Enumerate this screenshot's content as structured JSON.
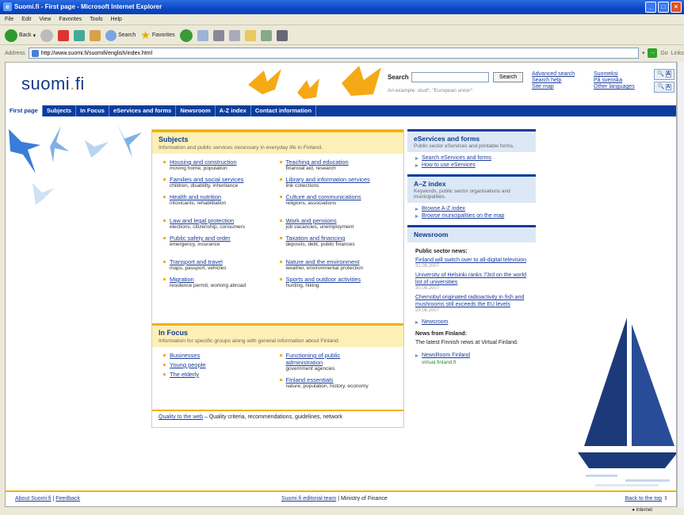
{
  "window": {
    "title": "Suomi.fi - First page - Microsoft Internet Explorer",
    "ie_logo": "e"
  },
  "menu": [
    "File",
    "Edit",
    "View",
    "Favorites",
    "Tools",
    "Help"
  ],
  "toolbar": {
    "back": "Back",
    "search": "Search",
    "favorites": "Favorites"
  },
  "address": {
    "label": "Address",
    "url": "http://www.suomi.fi/suomifi/english/index.html",
    "go": "Go",
    "links": "Links"
  },
  "site": {
    "logo_main": "suomi",
    "logo_dot": ".",
    "logo_tld": "fi"
  },
  "search": {
    "label": "Search",
    "button": "Search",
    "hint": "An example: stud*, \"European union\""
  },
  "header_links": [
    "Advanced search",
    "Search help",
    "Site map"
  ],
  "languages": [
    "Suomeksi",
    "På svenska",
    "Other languages"
  ],
  "font_sizes": [
    "A",
    "A"
  ],
  "nav": [
    "First page",
    "Subjects",
    "In Focus",
    "eServices and forms",
    "Newsroom",
    "A-Z index",
    "Contact information"
  ],
  "subjects": {
    "title": "Subjects",
    "desc": "Information and public services necessary in everyday life in Finland.",
    "left": [
      {
        "link": "Housing and construction",
        "sub": "moving home, population"
      },
      {
        "link": "Families and social services",
        "sub": "children, disability, inheritance"
      },
      {
        "link": "Health and nutrition",
        "sub": "intoxicants, rehabilitation"
      },
      {
        "link": "Law and legal protection",
        "sub": "elections, citizenship, consumers"
      },
      {
        "link": "Public safety and order",
        "sub": "emergency, insurance"
      },
      {
        "link": "Transport and travel",
        "sub": "maps, passport, vehicles"
      },
      {
        "link": "Migration",
        "sub": "residence permit, working abroad"
      }
    ],
    "right": [
      {
        "link": "Teaching and education",
        "sub": "financial aid, research"
      },
      {
        "link": "Library and information services",
        "sub": "link collections"
      },
      {
        "link": "Culture and communications",
        "sub": "religions, associations"
      },
      {
        "link": "Work and pensions",
        "sub": "job vacancies, unemployment"
      },
      {
        "link": "Taxation and financing",
        "sub": "deposits, debt, public finances"
      },
      {
        "link": "Nature and the environment",
        "sub": "weather, environmental protection"
      },
      {
        "link": "Sports and outdoor activities",
        "sub": "hunting, hiking"
      }
    ]
  },
  "infocus": {
    "title": "In Focus",
    "desc": "Information for specific groups along with general information about Finland.",
    "left": [
      "Businesses",
      "Young people",
      "The elderly"
    ],
    "right": [
      {
        "link": "Functioning of public administration",
        "sub": "government agencies"
      },
      {
        "link": "Finland essentials",
        "sub": "nature, population, history, economy"
      }
    ]
  },
  "quality": {
    "link": "Quality to the web",
    "text": " – Quality criteria, recommendations, guidelines, network"
  },
  "eservices": {
    "title": "eServices and forms",
    "desc": "Public sector eServices and printable forms.",
    "links": [
      "Search eServices and forms",
      "How to use eServices"
    ]
  },
  "azindex": {
    "title": "A–Z index",
    "desc": "Keywords, public sector organisations and municipalities.",
    "links": [
      "Browse A-Z index",
      "Browse municipalities on the map"
    ]
  },
  "newsroom": {
    "title": "Newsroom",
    "public_heading": "Public sector news:",
    "items": [
      {
        "link": "Finland will switch over to all-digital television",
        "date": "31.08.2007"
      },
      {
        "link": "University of Helsinki ranks 73rd on the world list of universities",
        "date": "30.08.2007"
      },
      {
        "link": "Chernobyl originated radioactivity in fish and mushrooms still exceeds the EU levels",
        "date": "29.08.2007"
      }
    ],
    "newsroom_link": "Newsroom",
    "finland_heading": "News from Finland:",
    "finland_text": "The latest Finnish news at Virtual Finland.",
    "newsroom_finland": "NewsRoom Finland",
    "virtual": "virtual.finland.fi"
  },
  "footer": {
    "about": "About Suomi.fi",
    "feedback": "Feedback",
    "team": "Suomi.fi editorial team",
    "ministry": "Ministry of Finance",
    "top": "Back to the top"
  },
  "status": {
    "zone": "Internet"
  }
}
